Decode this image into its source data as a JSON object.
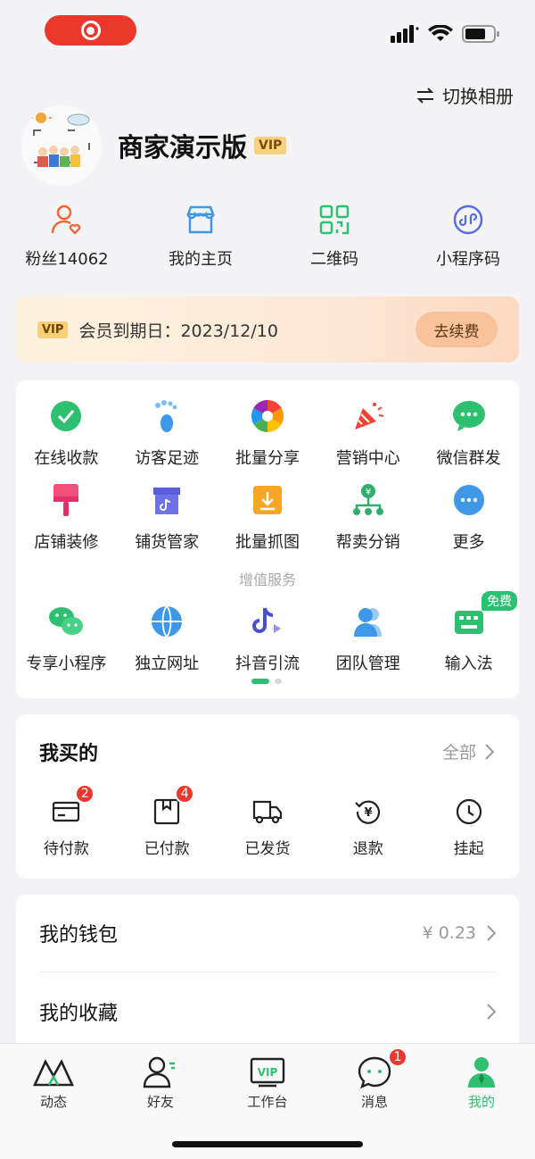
{
  "header": {
    "switch_album": "切换相册",
    "shop_name": "商家演示版",
    "vip_tag": "VIP"
  },
  "quick": [
    {
      "label": "粉丝14062",
      "icon": "fans-icon"
    },
    {
      "label": "我的主页",
      "icon": "shop-icon"
    },
    {
      "label": "二维码",
      "icon": "qrcode-icon"
    },
    {
      "label": "小程序码",
      "icon": "miniprogram-icon"
    }
  ],
  "vip_banner": {
    "tag": "VIP",
    "text": "会员到期日：2023/12/10",
    "button": "去续费"
  },
  "services": {
    "row1": [
      {
        "label": "在线收款",
        "icon": "payment-icon"
      },
      {
        "label": "访客足迹",
        "icon": "footprint-icon"
      },
      {
        "label": "批量分享",
        "icon": "aperture-icon"
      },
      {
        "label": "营销中心",
        "icon": "party-popper-icon"
      },
      {
        "label": "微信群发",
        "icon": "wechat-chat-icon"
      }
    ],
    "row2": [
      {
        "label": "店铺装修",
        "icon": "paint-roller-icon"
      },
      {
        "label": "铺货管家",
        "icon": "douyin-store-icon"
      },
      {
        "label": "批量抓图",
        "icon": "download-box-icon"
      },
      {
        "label": "帮卖分销",
        "icon": "distribution-icon"
      },
      {
        "label": "更多",
        "icon": "more-icon"
      }
    ],
    "section_title": "增值服务",
    "row3": [
      {
        "label": "专享小程序",
        "icon": "wechat-icon"
      },
      {
        "label": "独立网址",
        "icon": "globe-icon"
      },
      {
        "label": "抖音引流",
        "icon": "douyin-icon"
      },
      {
        "label": "团队管理",
        "icon": "team-icon"
      },
      {
        "label": "输入法",
        "icon": "keyboard-icon",
        "badge": "免费"
      }
    ]
  },
  "orders": {
    "title": "我买的",
    "all": "全部",
    "items": [
      {
        "label": "待付款",
        "icon": "card-icon",
        "badge": "2"
      },
      {
        "label": "已付款",
        "icon": "package-icon",
        "badge": "4"
      },
      {
        "label": "已发货",
        "icon": "truck-icon"
      },
      {
        "label": "退款",
        "icon": "refund-icon"
      },
      {
        "label": "挂起",
        "icon": "clock-icon"
      }
    ]
  },
  "list": [
    {
      "label": "我的钱包",
      "value": "¥ 0.23"
    },
    {
      "label": "我的收藏",
      "value": ""
    }
  ],
  "tabbar": [
    {
      "label": "动态",
      "icon": "moments-icon"
    },
    {
      "label": "好友",
      "icon": "friends-icon"
    },
    {
      "label": "工作台",
      "icon": "vip-workbench-icon",
      "icon_text": "VIP"
    },
    {
      "label": "消息",
      "icon": "message-icon",
      "badge": "1"
    },
    {
      "label": "我的",
      "icon": "profile-icon"
    }
  ],
  "colors": {
    "accent": "#2fbf71",
    "badge": "#e8392c",
    "vip_gold": "#f6cf77"
  }
}
